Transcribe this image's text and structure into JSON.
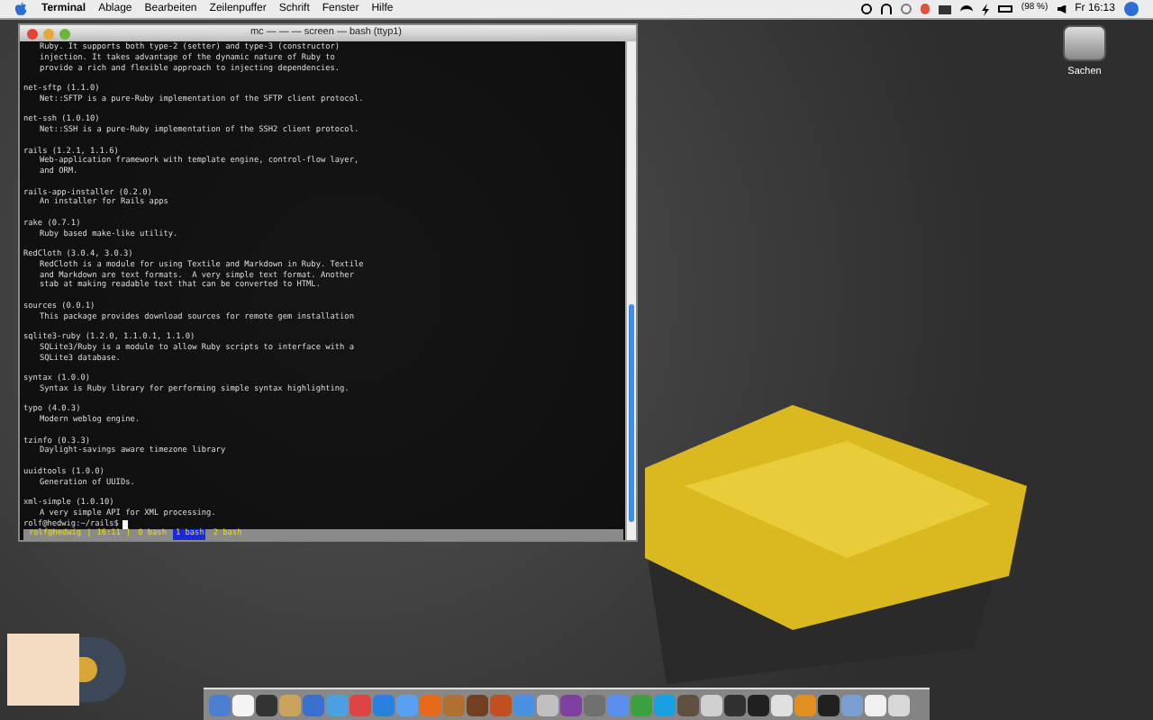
{
  "menu_bar": {
    "app": "Terminal",
    "items": [
      "Ablage",
      "Bearbeiten",
      "Zeilenpuffer",
      "Schrift",
      "Fenster",
      "Hilfe"
    ],
    "battery": "(98 %)",
    "clock": "Fr 16:13"
  },
  "desktop_icons": [
    {
      "label": "Sachen"
    }
  ],
  "terminal": {
    "title": "mc — — — screen — bash (ttyp1)",
    "entries": [
      {
        "description": [
          "Ruby. It supports both type-2 (setter) and type-3 (constructor)",
          "injection. It takes advantage of the dynamic nature of Ruby to",
          "provide a rich and flexible approach to injecting dependencies."
        ]
      },
      {
        "name": "net-sftp (1.1.0)",
        "description": [
          "Net::SFTP is a pure-Ruby implementation of the SFTP client protocol."
        ]
      },
      {
        "name": "net-ssh (1.0.10)",
        "description": [
          "Net::SSH is a pure-Ruby implementation of the SSH2 client protocol."
        ]
      },
      {
        "name": "rails (1.2.1, 1.1.6)",
        "description": [
          "Web-application framework with template engine, control-flow layer,",
          "and ORM."
        ]
      },
      {
        "name": "rails-app-installer (0.2.0)",
        "description": [
          "An installer for Rails apps"
        ]
      },
      {
        "name": "rake (0.7.1)",
        "description": [
          "Ruby based make-like utility."
        ]
      },
      {
        "name": "RedCloth (3.0.4, 3.0.3)",
        "description": [
          "RedCloth is a module for using Textile and Markdown in Ruby. Textile",
          "and Markdown are text formats.  A very simple text format. Another",
          "stab at making readable text that can be converted to HTML."
        ]
      },
      {
        "name": "sources (0.0.1)",
        "description": [
          "This package provides download sources for remote gem installation"
        ]
      },
      {
        "name": "sqlite3-ruby (1.2.0, 1.1.0.1, 1.1.0)",
        "description": [
          "SQLite3/Ruby is a module to allow Ruby scripts to interface with a",
          "SQLite3 database."
        ]
      },
      {
        "name": "syntax (1.0.0)",
        "description": [
          "Syntax is Ruby library for performing simple syntax highlighting."
        ]
      },
      {
        "name": "typo (4.0.3)",
        "description": [
          "Modern weblog engine."
        ]
      },
      {
        "name": "tzinfo (0.3.3)",
        "description": [
          "Daylight-savings aware timezone library"
        ]
      },
      {
        "name": "uuidtools (1.0.0)",
        "description": [
          "Generation of UUIDs."
        ]
      },
      {
        "name": "xml-simple (1.0.10)",
        "description": [
          "A very simple API for XML processing."
        ]
      }
    ],
    "prompt": "rolf@hedwig:~/rails$",
    "status": {
      "host": "rolf@hedwig",
      "separator": "|",
      "time": "16:11",
      "windows": [
        {
          "label": "0 bash",
          "selected": false
        },
        {
          "label": "1 bash",
          "selected": true
        },
        {
          "label": "2 bash",
          "selected": false
        }
      ]
    }
  }
}
